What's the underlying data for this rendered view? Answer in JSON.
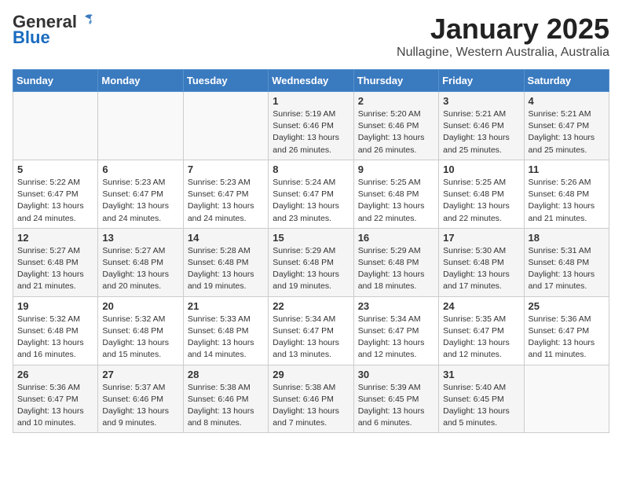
{
  "header": {
    "logo": {
      "line1": "General",
      "line2": "Blue"
    },
    "title": "January 2025",
    "subtitle": "Nullagine, Western Australia, Australia"
  },
  "weekdays": [
    "Sunday",
    "Monday",
    "Tuesday",
    "Wednesday",
    "Thursday",
    "Friday",
    "Saturday"
  ],
  "weeks": [
    [
      {
        "day": "",
        "info": ""
      },
      {
        "day": "",
        "info": ""
      },
      {
        "day": "",
        "info": ""
      },
      {
        "day": "1",
        "info": "Sunrise: 5:19 AM\nSunset: 6:46 PM\nDaylight: 13 hours\nand 26 minutes."
      },
      {
        "day": "2",
        "info": "Sunrise: 5:20 AM\nSunset: 6:46 PM\nDaylight: 13 hours\nand 26 minutes."
      },
      {
        "day": "3",
        "info": "Sunrise: 5:21 AM\nSunset: 6:46 PM\nDaylight: 13 hours\nand 25 minutes."
      },
      {
        "day": "4",
        "info": "Sunrise: 5:21 AM\nSunset: 6:47 PM\nDaylight: 13 hours\nand 25 minutes."
      }
    ],
    [
      {
        "day": "5",
        "info": "Sunrise: 5:22 AM\nSunset: 6:47 PM\nDaylight: 13 hours\nand 24 minutes."
      },
      {
        "day": "6",
        "info": "Sunrise: 5:23 AM\nSunset: 6:47 PM\nDaylight: 13 hours\nand 24 minutes."
      },
      {
        "day": "7",
        "info": "Sunrise: 5:23 AM\nSunset: 6:47 PM\nDaylight: 13 hours\nand 24 minutes."
      },
      {
        "day": "8",
        "info": "Sunrise: 5:24 AM\nSunset: 6:47 PM\nDaylight: 13 hours\nand 23 minutes."
      },
      {
        "day": "9",
        "info": "Sunrise: 5:25 AM\nSunset: 6:48 PM\nDaylight: 13 hours\nand 22 minutes."
      },
      {
        "day": "10",
        "info": "Sunrise: 5:25 AM\nSunset: 6:48 PM\nDaylight: 13 hours\nand 22 minutes."
      },
      {
        "day": "11",
        "info": "Sunrise: 5:26 AM\nSunset: 6:48 PM\nDaylight: 13 hours\nand 21 minutes."
      }
    ],
    [
      {
        "day": "12",
        "info": "Sunrise: 5:27 AM\nSunset: 6:48 PM\nDaylight: 13 hours\nand 21 minutes."
      },
      {
        "day": "13",
        "info": "Sunrise: 5:27 AM\nSunset: 6:48 PM\nDaylight: 13 hours\nand 20 minutes."
      },
      {
        "day": "14",
        "info": "Sunrise: 5:28 AM\nSunset: 6:48 PM\nDaylight: 13 hours\nand 19 minutes."
      },
      {
        "day": "15",
        "info": "Sunrise: 5:29 AM\nSunset: 6:48 PM\nDaylight: 13 hours\nand 19 minutes."
      },
      {
        "day": "16",
        "info": "Sunrise: 5:29 AM\nSunset: 6:48 PM\nDaylight: 13 hours\nand 18 minutes."
      },
      {
        "day": "17",
        "info": "Sunrise: 5:30 AM\nSunset: 6:48 PM\nDaylight: 13 hours\nand 17 minutes."
      },
      {
        "day": "18",
        "info": "Sunrise: 5:31 AM\nSunset: 6:48 PM\nDaylight: 13 hours\nand 17 minutes."
      }
    ],
    [
      {
        "day": "19",
        "info": "Sunrise: 5:32 AM\nSunset: 6:48 PM\nDaylight: 13 hours\nand 16 minutes."
      },
      {
        "day": "20",
        "info": "Sunrise: 5:32 AM\nSunset: 6:48 PM\nDaylight: 13 hours\nand 15 minutes."
      },
      {
        "day": "21",
        "info": "Sunrise: 5:33 AM\nSunset: 6:48 PM\nDaylight: 13 hours\nand 14 minutes."
      },
      {
        "day": "22",
        "info": "Sunrise: 5:34 AM\nSunset: 6:47 PM\nDaylight: 13 hours\nand 13 minutes."
      },
      {
        "day": "23",
        "info": "Sunrise: 5:34 AM\nSunset: 6:47 PM\nDaylight: 13 hours\nand 12 minutes."
      },
      {
        "day": "24",
        "info": "Sunrise: 5:35 AM\nSunset: 6:47 PM\nDaylight: 13 hours\nand 12 minutes."
      },
      {
        "day": "25",
        "info": "Sunrise: 5:36 AM\nSunset: 6:47 PM\nDaylight: 13 hours\nand 11 minutes."
      }
    ],
    [
      {
        "day": "26",
        "info": "Sunrise: 5:36 AM\nSunset: 6:47 PM\nDaylight: 13 hours\nand 10 minutes."
      },
      {
        "day": "27",
        "info": "Sunrise: 5:37 AM\nSunset: 6:46 PM\nDaylight: 13 hours\nand 9 minutes."
      },
      {
        "day": "28",
        "info": "Sunrise: 5:38 AM\nSunset: 6:46 PM\nDaylight: 13 hours\nand 8 minutes."
      },
      {
        "day": "29",
        "info": "Sunrise: 5:38 AM\nSunset: 6:46 PM\nDaylight: 13 hours\nand 7 minutes."
      },
      {
        "day": "30",
        "info": "Sunrise: 5:39 AM\nSunset: 6:45 PM\nDaylight: 13 hours\nand 6 minutes."
      },
      {
        "day": "31",
        "info": "Sunrise: 5:40 AM\nSunset: 6:45 PM\nDaylight: 13 hours\nand 5 minutes."
      },
      {
        "day": "",
        "info": ""
      }
    ]
  ]
}
